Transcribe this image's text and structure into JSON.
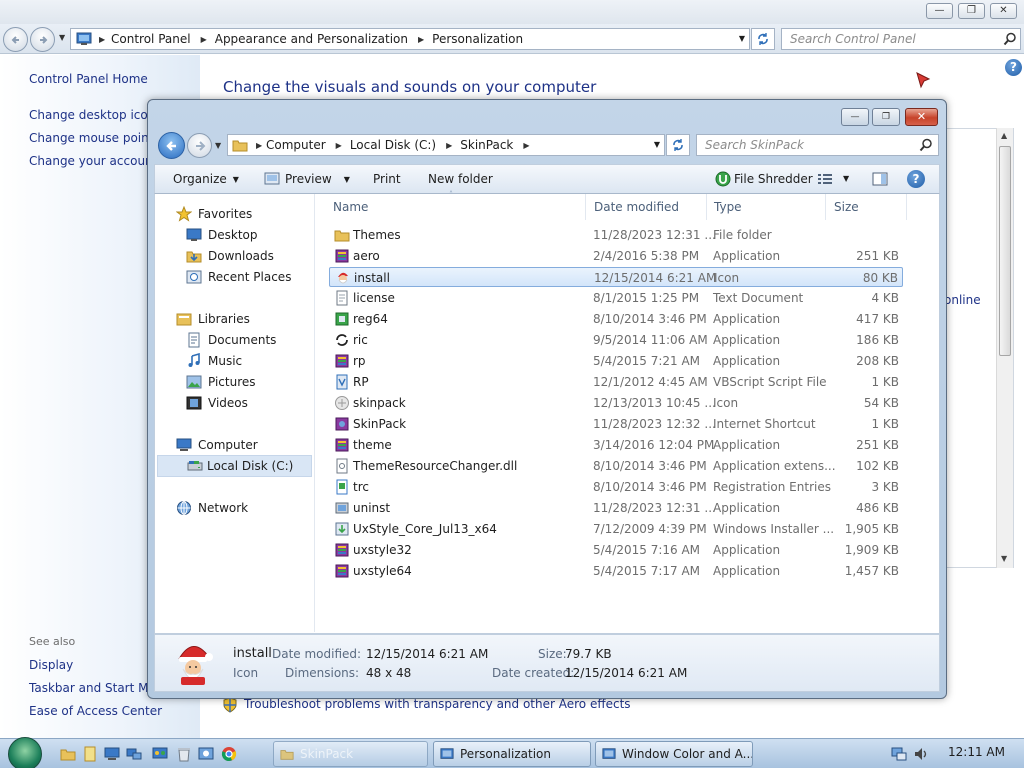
{
  "control_panel": {
    "breadcrumb": [
      "Control Panel",
      "Appearance and Personalization",
      "Personalization"
    ],
    "search_placeholder": "Search Control Panel",
    "left_links": [
      "Control Panel Home",
      "Change desktop icons",
      "Change mouse pointers",
      "Change your account"
    ],
    "see_also_label": "See also",
    "see_also_links": [
      "Display",
      "Taskbar and Start Menu",
      "Ease of Access Center"
    ],
    "heading": "Change the visuals and sounds on your computer",
    "online_link_fragment": "online",
    "troubleshoot_link": "Troubleshoot problems with transparency and other Aero effects",
    "help_glyph": "?"
  },
  "explorer": {
    "breadcrumb": [
      "Computer",
      "Local Disk (C:)",
      "SkinPack"
    ],
    "search_placeholder": "Search SkinPack",
    "toolbar": {
      "organize": "Organize",
      "preview": "Preview",
      "print": "Print",
      "new_folder": "New folder",
      "file_shredder": "File Shredder",
      "help_glyph": "?"
    },
    "nav": {
      "favorites": "Favorites",
      "favorites_items": [
        "Desktop",
        "Downloads",
        "Recent Places"
      ],
      "libraries": "Libraries",
      "libraries_items": [
        "Documents",
        "Music",
        "Pictures",
        "Videos"
      ],
      "computer": "Computer",
      "computer_items": [
        "Local Disk (C:)"
      ],
      "network": "Network"
    },
    "columns": [
      "Name",
      "Date modified",
      "Type",
      "Size"
    ],
    "files": [
      {
        "name": "Themes",
        "date": "11/28/2023 12:31 ...",
        "type": "File folder",
        "size": "",
        "icon": "folder-icon"
      },
      {
        "name": "aero",
        "date": "2/4/2016 5:38 PM",
        "type": "Application",
        "size": "251 KB",
        "icon": "winrar-sfx-icon"
      },
      {
        "name": "install",
        "date": "12/15/2014 6:21 AM",
        "type": "Icon",
        "size": "80 KB",
        "icon": "santa-icon",
        "selected": true
      },
      {
        "name": "license",
        "date": "8/1/2015 1:25 PM",
        "type": "Text Document",
        "size": "4 KB",
        "icon": "text-document-icon"
      },
      {
        "name": "reg64",
        "date": "8/10/2014 3:46 PM",
        "type": "Application",
        "size": "417 KB",
        "icon": "registry-app-icon"
      },
      {
        "name": "ric",
        "date": "9/5/2014 11:06 AM",
        "type": "Application",
        "size": "186 KB",
        "icon": "refresh-app-icon"
      },
      {
        "name": "rp",
        "date": "5/4/2015 7:21 AM",
        "type": "Application",
        "size": "208 KB",
        "icon": "winrar-sfx-icon"
      },
      {
        "name": "RP",
        "date": "12/1/2012 4:45 AM",
        "type": "VBScript Script File",
        "size": "1 KB",
        "icon": "vbscript-icon"
      },
      {
        "name": "skinpack",
        "date": "12/13/2013 10:45 ...",
        "type": "Icon",
        "size": "54 KB",
        "icon": "skinpack-icon"
      },
      {
        "name": "SkinPack",
        "date": "11/28/2023 12:32 ...",
        "type": "Internet Shortcut",
        "size": "1 KB",
        "icon": "internet-shortcut-icon"
      },
      {
        "name": "theme",
        "date": "3/14/2016 12:04 PM",
        "type": "Application",
        "size": "251 KB",
        "icon": "winrar-sfx-icon"
      },
      {
        "name": "ThemeResourceChanger.dll",
        "date": "8/10/2014 3:46 PM",
        "type": "Application extens...",
        "size": "102 KB",
        "icon": "dll-icon"
      },
      {
        "name": "trc",
        "date": "8/10/2014 3:46 PM",
        "type": "Registration Entries",
        "size": "3 KB",
        "icon": "registry-entries-icon"
      },
      {
        "name": "uninst",
        "date": "11/28/2023 12:31 ...",
        "type": "Application",
        "size": "486 KB",
        "icon": "uninstall-icon"
      },
      {
        "name": "UxStyle_Core_Jul13_x64",
        "date": "7/12/2009 4:39 PM",
        "type": "Windows Installer ...",
        "size": "1,905 KB",
        "icon": "installer-icon"
      },
      {
        "name": "uxstyle32",
        "date": "5/4/2015 7:16 AM",
        "type": "Application",
        "size": "1,909 KB",
        "icon": "winrar-sfx-icon"
      },
      {
        "name": "uxstyle64",
        "date": "5/4/2015 7:17 AM",
        "type": "Application",
        "size": "1,457 KB",
        "icon": "winrar-sfx-icon"
      }
    ],
    "details": {
      "name": "install",
      "kind": "Icon",
      "date_modified_label": "Date modified:",
      "date_modified": "12/15/2014 6:21 AM",
      "dimensions_label": "Dimensions:",
      "dimensions": "48 x 48",
      "size_label": "Size:",
      "size": "79.7 KB",
      "date_created_label": "Date created:",
      "date_created": "12/15/2014 6:21 AM"
    }
  },
  "taskbar": {
    "buttons": [
      "SkinPack",
      "Personalization",
      "Window Color and A..."
    ],
    "clock": "12:11 AM"
  },
  "colors": {
    "link": "#1e3287",
    "selection": "#d3e5fa",
    "close_button": "#c7432a"
  }
}
